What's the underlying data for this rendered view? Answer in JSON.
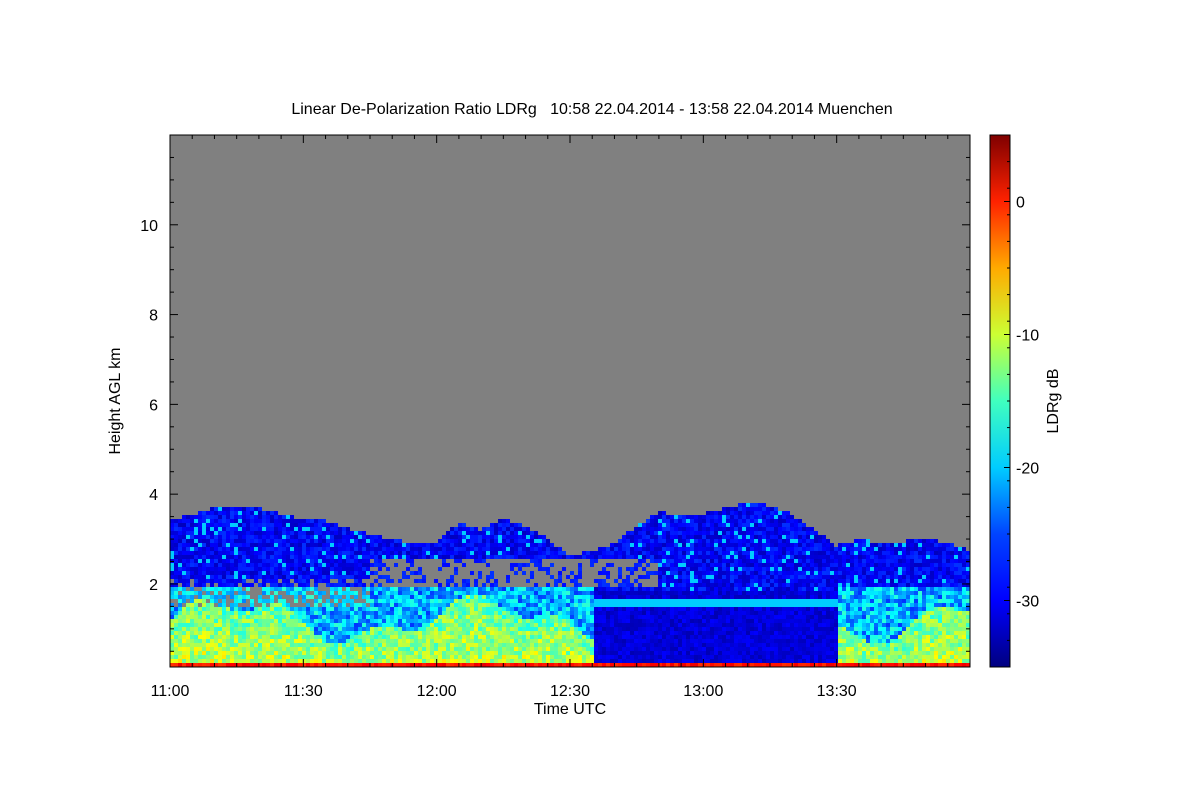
{
  "chart_data": {
    "type": "heatmap",
    "title": "Linear De-Polarization Ratio LDRg   10:58 22.04.2014 - 13:58 22.04.2014 Muenchen",
    "xlabel": "Time UTC",
    "ylabel": "Height AGL km",
    "x_ticks": [
      "11:00",
      "11:30",
      "12:00",
      "12:30",
      "13:00",
      "13:30"
    ],
    "x_tick_minutes": [
      0,
      30,
      60,
      90,
      120,
      150
    ],
    "xlim_minutes": [
      0,
      180
    ],
    "y_ticks": [
      2,
      4,
      6,
      8,
      10
    ],
    "ylim": [
      0.15,
      12.0
    ],
    "colorbar": {
      "label": "LDRg dB",
      "ticks": [
        0,
        -10,
        -20,
        -30
      ],
      "range": [
        -35,
        5
      ]
    },
    "background_color": "#808080",
    "colormap": [
      "#00007f",
      "#0000ff",
      "#007fff",
      "#00ffff",
      "#7fff7f",
      "#ffff00",
      "#ff7f00",
      "#ff0000",
      "#7f0000"
    ],
    "cloud_top_profile_km": [
      [
        0,
        3.4
      ],
      [
        5,
        3.55
      ],
      [
        10,
        3.7
      ],
      [
        15,
        3.75
      ],
      [
        20,
        3.7
      ],
      [
        25,
        3.55
      ],
      [
        30,
        3.45
      ],
      [
        35,
        3.4
      ],
      [
        40,
        3.25
      ],
      [
        45,
        3.1
      ],
      [
        50,
        3.0
      ],
      [
        55,
        2.9
      ],
      [
        60,
        2.95
      ],
      [
        65,
        3.35
      ],
      [
        70,
        3.2
      ],
      [
        75,
        3.45
      ],
      [
        80,
        3.3
      ],
      [
        85,
        3.0
      ],
      [
        90,
        2.6
      ],
      [
        95,
        2.75
      ],
      [
        100,
        2.9
      ],
      [
        105,
        3.3
      ],
      [
        110,
        3.6
      ],
      [
        115,
        3.55
      ],
      [
        120,
        3.55
      ],
      [
        125,
        3.7
      ],
      [
        130,
        3.8
      ],
      [
        135,
        3.75
      ],
      [
        140,
        3.55
      ],
      [
        145,
        3.2
      ],
      [
        150,
        2.85
      ],
      [
        155,
        3.0
      ],
      [
        160,
        2.9
      ],
      [
        165,
        2.95
      ],
      [
        170,
        3.05
      ],
      [
        175,
        2.9
      ],
      [
        180,
        2.75
      ]
    ]
  }
}
